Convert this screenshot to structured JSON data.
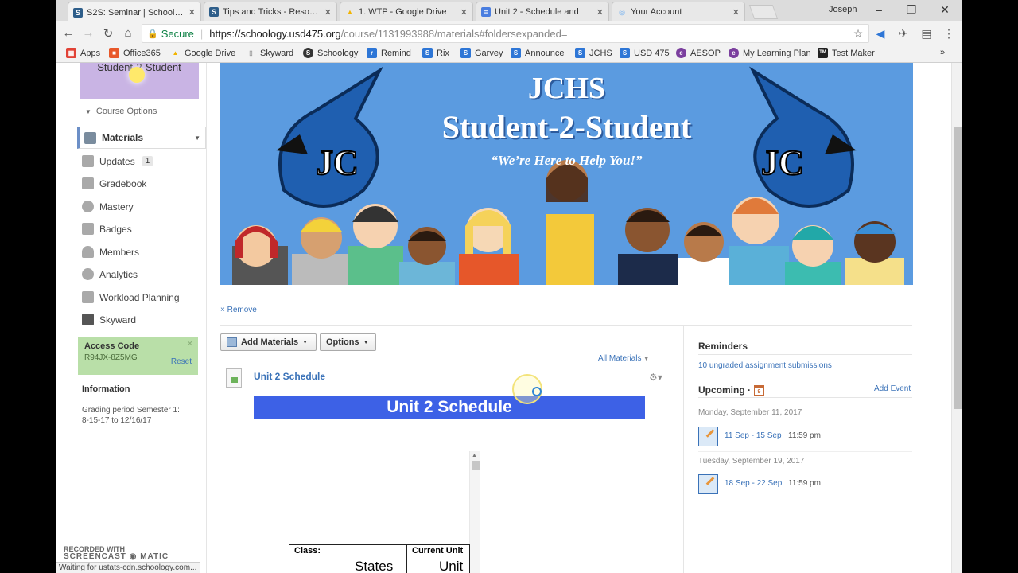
{
  "browser": {
    "tabs": [
      {
        "title": "S2S: Seminar | Schoology",
        "favicon": "S",
        "color": "#2e5e8a",
        "active": true
      },
      {
        "title": "Tips and Tricks - Resourc",
        "favicon": "S",
        "color": "#2e5e8a",
        "active": false
      },
      {
        "title": "1. WTP - Google Drive",
        "favicon": "▲",
        "color": "#f2b400",
        "active": false
      },
      {
        "title": "Unit 2 - Schedule and",
        "favicon": "≡",
        "color": "#4a7ee0",
        "active": false
      },
      {
        "title": "Your Account",
        "favicon": "◎",
        "color": "#9cc4ee",
        "active": false
      }
    ],
    "user": "Joseph",
    "secure_label": "Secure",
    "url_host": "https://schoology.usd475.org",
    "url_path": "/course/1131993988/materials#foldersexpanded=",
    "bookmarks": [
      {
        "label": "Apps",
        "color": "#e14236",
        "icon": "▦"
      },
      {
        "label": "Office365",
        "color": "#e8582a",
        "icon": "■"
      },
      {
        "label": "Google Drive",
        "color": "#f2b400",
        "icon": "▲"
      },
      {
        "label": "Skyward",
        "color": "#999999",
        "icon": "▯"
      },
      {
        "label": "Schoology",
        "color": "#333333",
        "icon": "S"
      },
      {
        "label": "Remind",
        "color": "#2e76d6",
        "icon": "r"
      },
      {
        "label": "Rix",
        "color": "#2e76d6",
        "icon": "S"
      },
      {
        "label": "Garvey",
        "color": "#2e76d6",
        "icon": "S"
      },
      {
        "label": "Announce",
        "color": "#2e76d6",
        "icon": "S"
      },
      {
        "label": "JCHS",
        "color": "#2e76d6",
        "icon": "S"
      },
      {
        "label": "USD 475",
        "color": "#2e76d6",
        "icon": "S"
      },
      {
        "label": "AESOP",
        "color": "#7b3f9e",
        "icon": "e"
      },
      {
        "label": "My Learning Plan",
        "color": "#7b3f9e",
        "icon": "e"
      },
      {
        "label": "Test Maker",
        "color": "#222222",
        "icon": "TM"
      }
    ],
    "more_bookmarks": "»",
    "status": "Waiting for ustats-cdn.schoology.com..."
  },
  "sidebar": {
    "course_caption": "Student-2-Student",
    "course_options": "Course Options",
    "active_item": "Materials",
    "items": [
      {
        "label": "Updates",
        "badge": "1"
      },
      {
        "label": "Gradebook"
      },
      {
        "label": "Mastery"
      },
      {
        "label": "Badges"
      },
      {
        "label": "Members"
      },
      {
        "label": "Analytics"
      },
      {
        "label": "Workload Planning"
      },
      {
        "label": "Skyward"
      }
    ],
    "access_code": {
      "title": "Access Code",
      "code": "R94JX-8Z5MG",
      "reset": "Reset"
    },
    "information": {
      "title": "Information",
      "text": "Grading period Semester 1: 8-15-17 to 12/16/17"
    }
  },
  "banner": {
    "line1": "JCHS",
    "line2": "Student-2-Student",
    "tagline": "“We’re Here to Help You!”",
    "colors": {
      "background": "#5b9be0",
      "mascot": "#1f5fb0"
    }
  },
  "main": {
    "remove_link": "× Remove",
    "add_materials": "Add Materials",
    "options": "Options",
    "all_materials": "All Materials",
    "item_title": "Unit 2 Schedule",
    "bar_text": "Unit 2 Schedule",
    "doc_table": [
      {
        "header": "Class:",
        "value": "States"
      },
      {
        "header": "Current Unit",
        "value": "Unit"
      }
    ]
  },
  "right": {
    "reminders_title": "Reminders",
    "reminders_link": "10 ungraded assignment submissions",
    "upcoming_title": "Upcoming ·",
    "add_event": "Add Event",
    "events": [
      {
        "date": "Monday, September 11, 2017",
        "title": "11 Sep - 15 Sep",
        "time": "11:59 pm"
      },
      {
        "date": "Tuesday, September 19, 2017",
        "title": "18 Sep - 22 Sep",
        "time": "11:59 pm"
      }
    ]
  },
  "watermark": {
    "line1": "RECORDED WITH",
    "line2": "SCREENCAST",
    "line3": "MATIC"
  }
}
